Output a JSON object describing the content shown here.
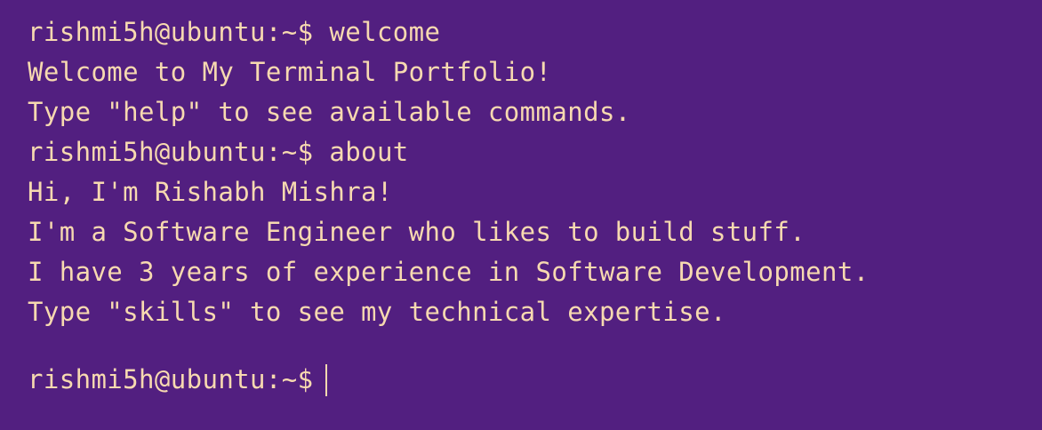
{
  "terminal": {
    "prompt": "rishmi5h@ubuntu:~$",
    "colors": {
      "background": "#521f80",
      "text": "#f7d9b0"
    },
    "history": [
      {
        "command": "welcome",
        "output": [
          "Welcome to My Terminal Portfolio!",
          "Type \"help\" to see available commands."
        ]
      },
      {
        "command": "about",
        "output": [
          "Hi, I'm Rishabh Mishra!",
          "I'm a Software Engineer who likes to build stuff.",
          "I have 3 years of experience in Software Development.",
          "Type \"skills\" to see my technical expertise."
        ]
      }
    ],
    "current_input": ""
  }
}
